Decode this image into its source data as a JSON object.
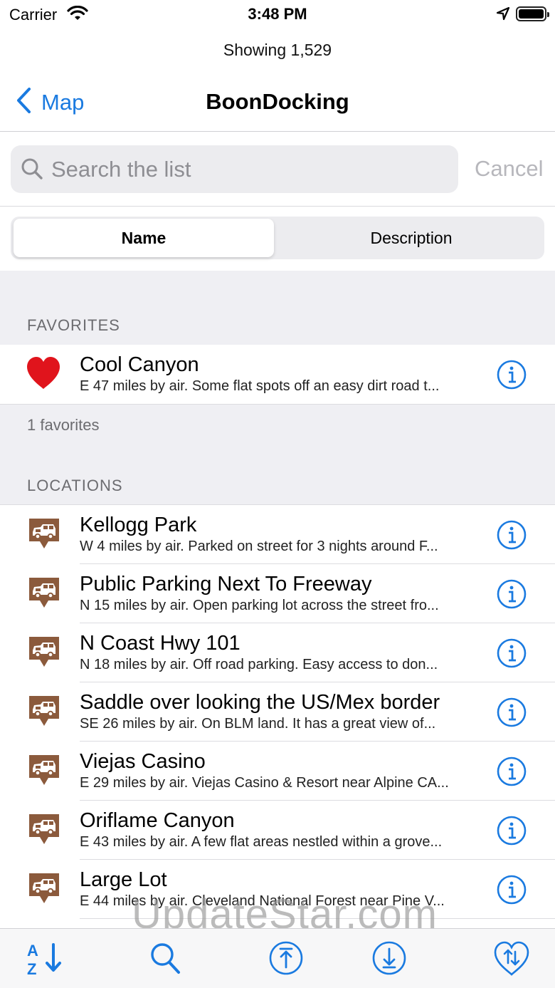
{
  "status_bar": {
    "carrier": "Carrier",
    "time": "3:48 PM"
  },
  "nav": {
    "prompt": "Showing 1,529",
    "back_label": "Map",
    "title": "BoonDocking"
  },
  "search": {
    "placeholder": "Search the list",
    "cancel_label": "Cancel"
  },
  "segments": {
    "name_label": "Name",
    "description_label": "Description",
    "selected": "Name"
  },
  "favorites": {
    "header": "FAVORITES",
    "items": [
      {
        "title": "Cool Canyon",
        "subtitle": "E 47 miles by air. Some flat spots off an easy dirt road t..."
      }
    ],
    "footer": "1 favorites"
  },
  "locations": {
    "header": "LOCATIONS",
    "items": [
      {
        "title": "Kellogg Park",
        "subtitle": "W 4 miles by air. Parked on street for 3 nights around F..."
      },
      {
        "title": "Public Parking Next To Freeway",
        "subtitle": "N 15 miles by air. Open parking lot across the street fro..."
      },
      {
        "title": "N Coast Hwy 101",
        "subtitle": "N 18 miles by air. Off road parking.  Easy access to don..."
      },
      {
        "title": "Saddle over looking the US/Mex border",
        "subtitle": "SE 26 miles by air. On BLM land.  It has a great view of..."
      },
      {
        "title": "Viejas Casino",
        "subtitle": "E 29 miles by air. Viejas Casino & Resort near Alpine CA..."
      },
      {
        "title": "Oriflame Canyon",
        "subtitle": "E 43 miles by air. A few flat areas nestled within a grove..."
      },
      {
        "title": "Large Lot",
        "subtitle": "E 44 miles by air. Cleveland National Forest near Pine V..."
      }
    ]
  },
  "toolbar": [
    "sort-az-icon",
    "search-icon",
    "scroll-top-icon",
    "scroll-bottom-icon",
    "favorites-sort-icon"
  ],
  "watermark": "UpdateStar.com",
  "colors": {
    "accent": "#1a7ae0",
    "heart": "#e0141c",
    "camp_icon": "#8b5a3c"
  }
}
